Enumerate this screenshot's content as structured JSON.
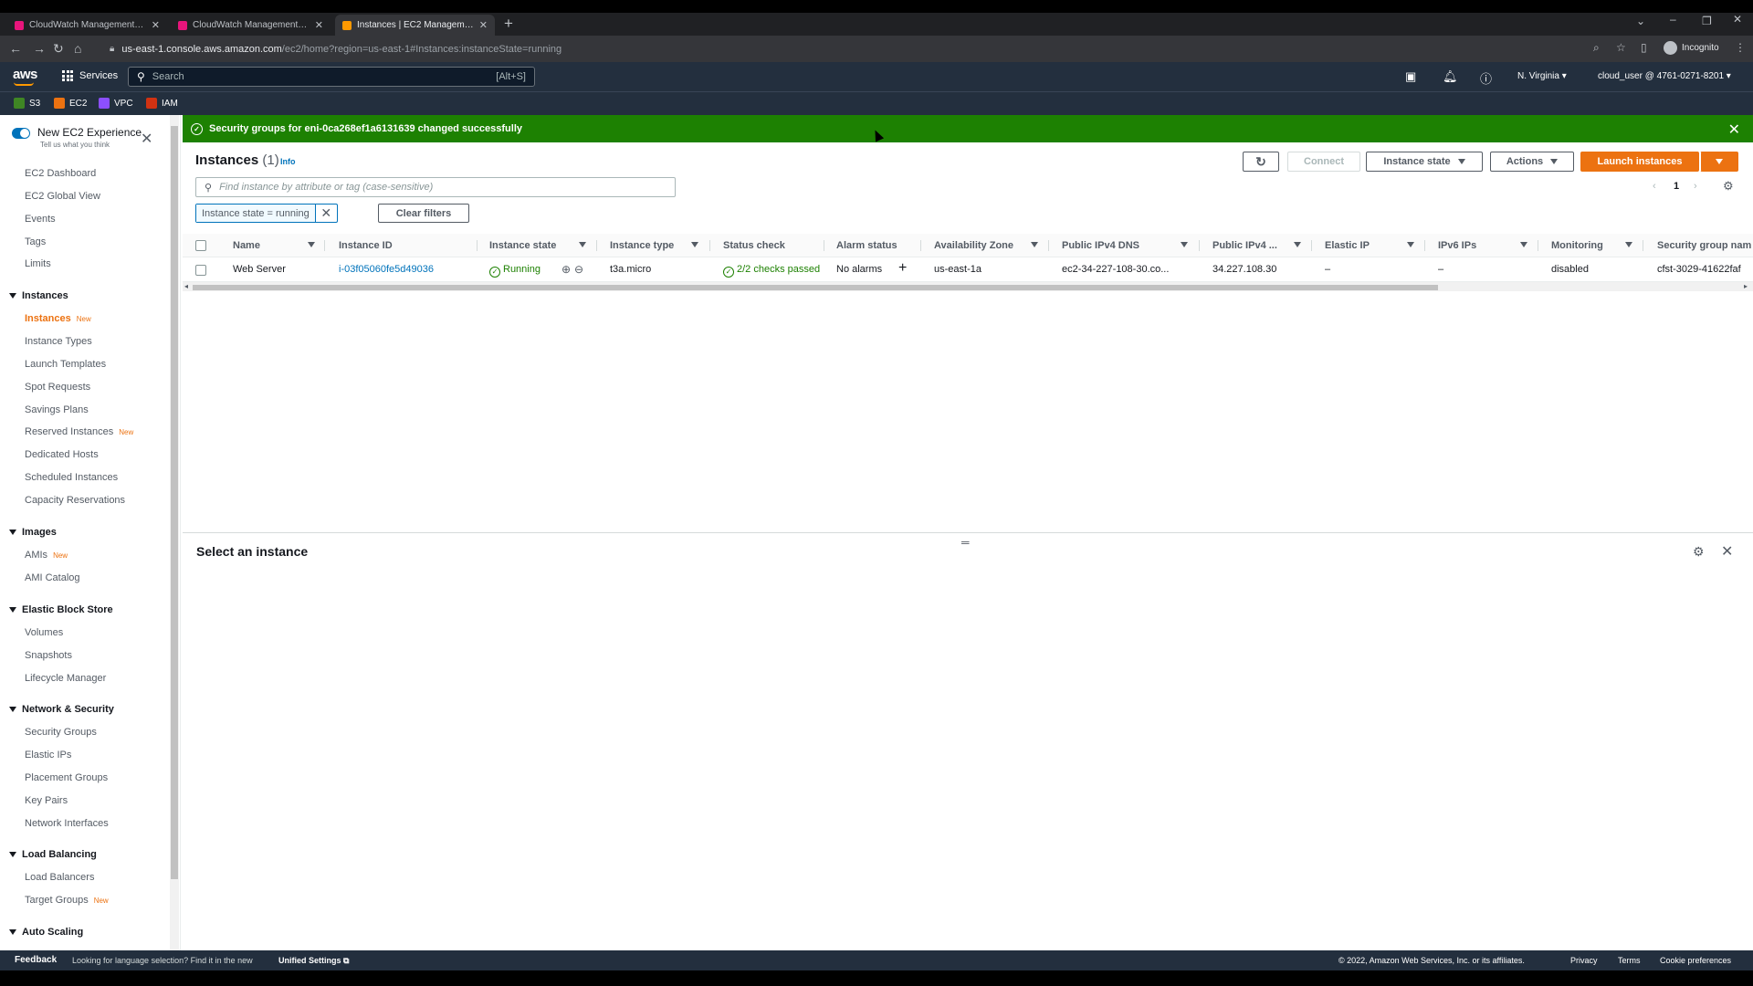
{
  "browser": {
    "tabs": [
      {
        "title": "CloudWatch Management Console",
        "active": false
      },
      {
        "title": "CloudWatch Management Console",
        "active": false
      },
      {
        "title": "Instances | EC2 Management Console",
        "active": true
      }
    ],
    "url_host": "us-east-1.console.aws.amazon.com",
    "url_path": "/ec2/home?region=us-east-1#Instances:instanceState=running",
    "incognito_label": "Incognito"
  },
  "aws_header": {
    "logo": "aws",
    "services_label": "Services",
    "search_placeholder": "Search",
    "search_shortcut": "[Alt+S]",
    "region": "N. Virginia",
    "account": "cloud_user @ 4761-0271-8201",
    "favorites": [
      {
        "label": "S3",
        "color": "#3f8624"
      },
      {
        "label": "EC2",
        "color": "#ec7211"
      },
      {
        "label": "VPC",
        "color": "#8c4fff"
      },
      {
        "label": "IAM",
        "color": "#d13212"
      }
    ]
  },
  "sidebar": {
    "new_experience": "New EC2 Experience",
    "new_experience_sub": "Tell us what you think",
    "top_items": [
      "EC2 Dashboard",
      "EC2 Global View",
      "Events",
      "Tags",
      "Limits"
    ],
    "sections": [
      {
        "title": "Instances",
        "items": [
          {
            "label": "Instances",
            "badge": "New",
            "active": true
          },
          {
            "label": "Instance Types"
          },
          {
            "label": "Launch Templates"
          },
          {
            "label": "Spot Requests"
          },
          {
            "label": "Savings Plans"
          },
          {
            "label": "Reserved Instances",
            "badge": "New"
          },
          {
            "label": "Dedicated Hosts"
          },
          {
            "label": "Scheduled Instances"
          },
          {
            "label": "Capacity Reservations"
          }
        ]
      },
      {
        "title": "Images",
        "items": [
          {
            "label": "AMIs",
            "badge": "New"
          },
          {
            "label": "AMI Catalog"
          }
        ]
      },
      {
        "title": "Elastic Block Store",
        "items": [
          {
            "label": "Volumes"
          },
          {
            "label": "Snapshots"
          },
          {
            "label": "Lifecycle Manager"
          }
        ]
      },
      {
        "title": "Network & Security",
        "items": [
          {
            "label": "Security Groups"
          },
          {
            "label": "Elastic IPs"
          },
          {
            "label": "Placement Groups"
          },
          {
            "label": "Key Pairs"
          },
          {
            "label": "Network Interfaces"
          }
        ]
      },
      {
        "title": "Load Balancing",
        "items": [
          {
            "label": "Load Balancers"
          },
          {
            "label": "Target Groups",
            "badge": "New"
          }
        ]
      },
      {
        "title": "Auto Scaling",
        "items": []
      }
    ]
  },
  "flash": {
    "message": "Security groups for eni-0ca268ef1a6131639 changed successfully",
    "color": "#1d8102"
  },
  "instances": {
    "title": "Instances",
    "count": "(1)",
    "info": "Info",
    "buttons": {
      "connect": "Connect",
      "instance_state": "Instance state",
      "actions": "Actions",
      "launch": "Launch instances"
    },
    "find_placeholder": "Find instance by attribute or tag (case-sensitive)",
    "page": "1",
    "filter_token": "Instance state = running",
    "clear_filters": "Clear filters",
    "columns": [
      "Name",
      "Instance ID",
      "Instance state",
      "Instance type",
      "Status check",
      "Alarm status",
      "Availability Zone",
      "Public IPv4 DNS",
      "Public IPv4 ...",
      "Elastic IP",
      "IPv6 IPs",
      "Monitoring",
      "Security group nam"
    ],
    "row": {
      "name": "Web Server",
      "instance_id": "i-03f05060fe5d49036",
      "state": "Running",
      "type": "t3a.micro",
      "status_check": "2/2 checks passed",
      "alarm_status": "No alarms",
      "az": "us-east-1a",
      "dns": "ec2-34-227-108-30.co...",
      "ipv4": "34.227.108.30",
      "elastic_ip": "–",
      "ipv6": "–",
      "monitoring": "disabled",
      "security_group": "cfst-3029-41622faf"
    }
  },
  "detail": {
    "title": "Select an instance"
  },
  "footer": {
    "feedback": "Feedback",
    "language_hint": "Looking for language selection? Find it in the new",
    "unified_settings": "Unified Settings",
    "copyright": "© 2022, Amazon Web Services, Inc. or its affiliates.",
    "privacy": "Privacy",
    "terms": "Terms",
    "cookies": "Cookie preferences"
  }
}
